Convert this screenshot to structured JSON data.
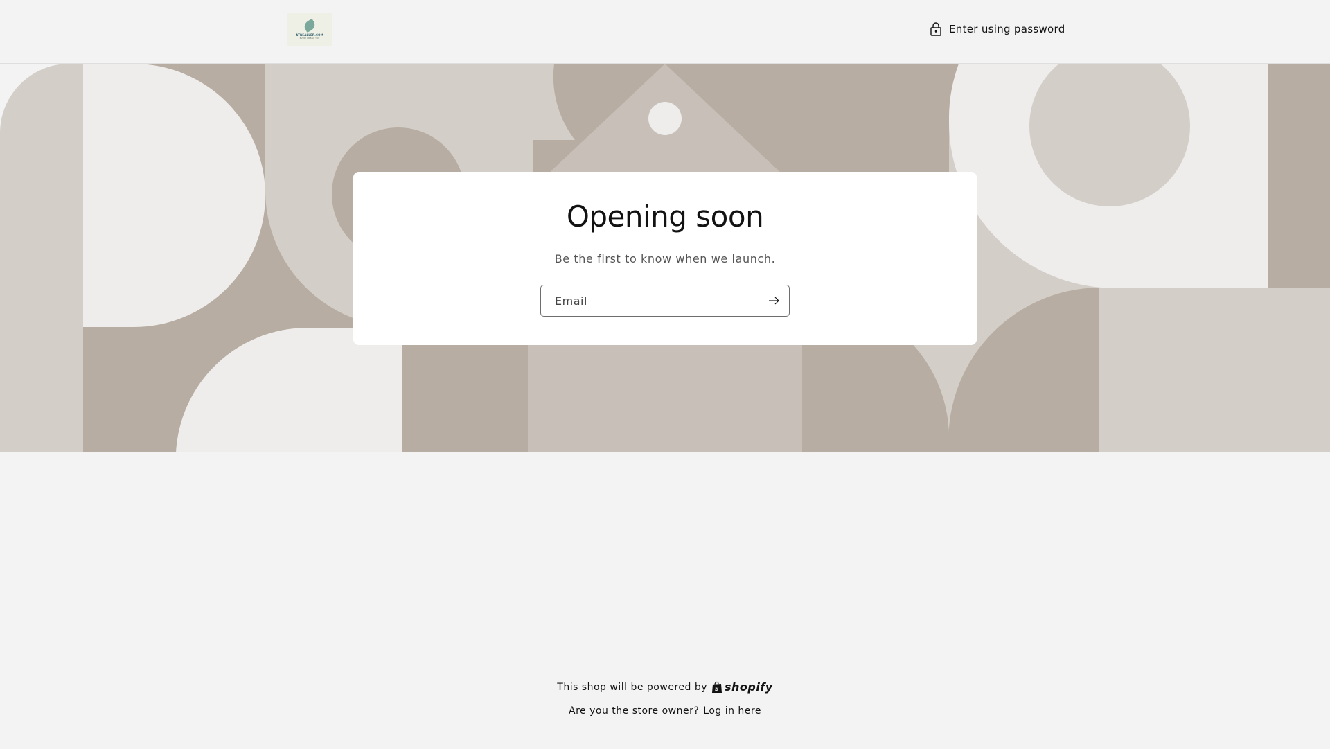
{
  "header": {
    "logo": {
      "text": "ATREALLER.COM",
      "subtext": "EVERY DREAM YOU"
    },
    "password_link_label": "Enter using password"
  },
  "main": {
    "title": "Opening soon",
    "subtitle": "Be the first to know when we launch.",
    "email_placeholder": "Email"
  },
  "footer": {
    "powered_text": "This shop will be powered by",
    "brand": "shopify",
    "owner_question": "Are you the store owner?",
    "login_link": "Log in here"
  },
  "colors": {
    "page_bg": "#f3f3f3",
    "banner_dark": "#b7ada2",
    "banner_mid": "#d3cec8",
    "banner_light": "#eeedeb",
    "banner_taupe": "#c7bfb8",
    "text": "#121212"
  },
  "icons": {
    "lock": "lock-icon",
    "arrow": "arrow-right-icon",
    "shopify_bag": "shopify-bag-icon"
  }
}
